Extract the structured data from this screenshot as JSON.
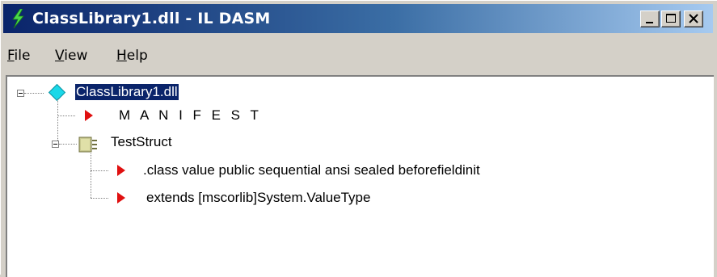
{
  "window": {
    "title": "ClassLibrary1.dll - IL DASM",
    "controls": [
      "minimize",
      "maximize",
      "close"
    ]
  },
  "menu": {
    "items": [
      {
        "label": "File",
        "accel": "F",
        "rest": "ile"
      },
      {
        "label": "View",
        "accel": "V",
        "rest": "iew"
      },
      {
        "label": "Help",
        "accel": "H",
        "rest": "elp"
      }
    ]
  },
  "tree": {
    "root": {
      "label": "ClassLibrary1.dll",
      "icon": "assembly-diamond-icon",
      "selected": true
    },
    "manifest": {
      "label": "M A N I F E S T",
      "icon": "red-triangle-icon"
    },
    "type": {
      "label": "TestStruct",
      "icon": "struct-icon"
    },
    "members": [
      {
        "label": ".class value public sequential ansi sealed beforefieldinit",
        "icon": "red-triangle-icon"
      },
      {
        "label": "extends [mscorlib]System.ValueType",
        "icon": "red-triangle-icon"
      }
    ]
  },
  "colors": {
    "titlebar_start": "#0a246a",
    "titlebar_end": "#a6caf0",
    "selection": "#0a246a",
    "triangle": "#e01010",
    "diamond": "#1ad8e8"
  }
}
